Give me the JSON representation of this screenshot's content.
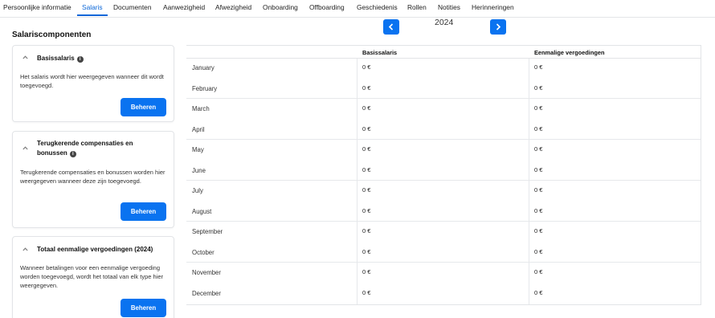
{
  "tabs": [
    {
      "label": "Persoonlijke informatie"
    },
    {
      "label": "Salaris"
    },
    {
      "label": "Documenten"
    },
    {
      "label": "Aanwezigheid"
    },
    {
      "label": "Afwezigheid"
    },
    {
      "label": "Onboarding"
    },
    {
      "label": "Offboarding"
    },
    {
      "label": "Geschiedenis"
    },
    {
      "label": "Rollen"
    },
    {
      "label": "Notities"
    },
    {
      "label": "Herinneringen"
    }
  ],
  "active_tab": "Salaris",
  "sidebar": {
    "title": "Salariscomponenten",
    "cards": [
      {
        "title": "Basissalaris",
        "text": "Het salaris wordt hier weergegeven wanneer dit wordt toegevoegd.",
        "button": "Beheren"
      },
      {
        "title": "Terugkerende compensaties en bonussen",
        "text": "Terugkerende compensaties en bonussen worden hier weergegeven wanneer deze zijn toegevoegd.",
        "button": "Beheren"
      },
      {
        "title": "Totaal eenmalige vergoedingen (2024)",
        "text": "Wanneer betalingen voor een eenmalige vergoeding worden toegevoegd, wordt het totaal van elk type hier weergegeven.",
        "button": "Beheren"
      }
    ]
  },
  "year_nav": {
    "year": "2024"
  },
  "table": {
    "columns": [
      "Basissalaris",
      "Eenmalige vergoedingen"
    ],
    "rows": [
      {
        "month": "January",
        "basis": "0 €",
        "eenmalig": "0 €"
      },
      {
        "month": "February",
        "basis": "0 €",
        "eenmalig": "0 €"
      },
      {
        "month": "March",
        "basis": "0 €",
        "eenmalig": "0 €"
      },
      {
        "month": "April",
        "basis": "0 €",
        "eenmalig": "0 €"
      },
      {
        "month": "May",
        "basis": "0 €",
        "eenmalig": "0 €"
      },
      {
        "month": "June",
        "basis": "0 €",
        "eenmalig": "0 €"
      },
      {
        "month": "July",
        "basis": "0 €",
        "eenmalig": "0 €"
      },
      {
        "month": "August",
        "basis": "0 €",
        "eenmalig": "0 €"
      },
      {
        "month": "September",
        "basis": "0 €",
        "eenmalig": "0 €"
      },
      {
        "month": "October",
        "basis": "0 €",
        "eenmalig": "0 €"
      },
      {
        "month": "November",
        "basis": "0 €",
        "eenmalig": "0 €"
      },
      {
        "month": "December",
        "basis": "0 €",
        "eenmalig": "0 €"
      }
    ]
  },
  "colors": {
    "accent": "#0a73f0",
    "active_tab": "#0a66d8",
    "border": "#e2e4e7"
  },
  "icons": {
    "info": "info-icon",
    "collapse": "chevron-up-icon",
    "prev": "chevron-left-icon",
    "next": "chevron-right-icon"
  }
}
